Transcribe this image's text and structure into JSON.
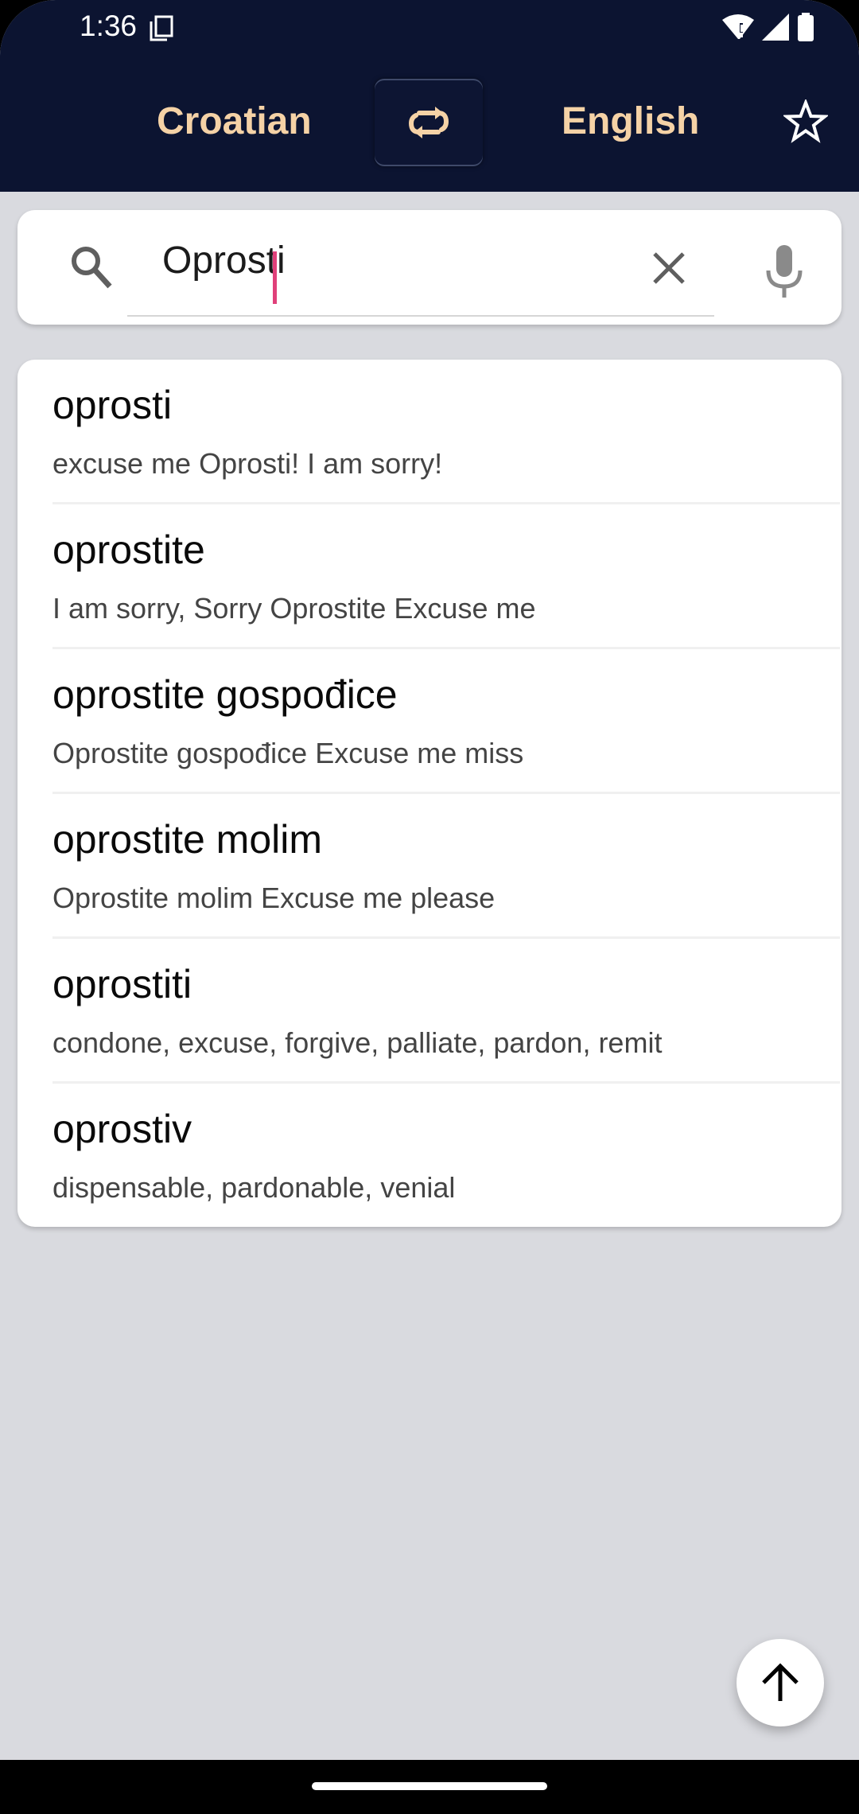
{
  "status_bar": {
    "time": "1:36",
    "icons": [
      "notification-note-icon",
      "wifi-alert-icon",
      "cellular-signal-icon",
      "battery-icon"
    ]
  },
  "header": {
    "source_language": "Croatian",
    "target_language": "English",
    "swap_icon": "swap-languages-icon",
    "favorite_icon": "star-outline-icon"
  },
  "search": {
    "value": "Oprosti",
    "placeholder": "",
    "search_icon": "search-icon",
    "clear_icon": "close-icon",
    "voice_icon": "microphone-icon"
  },
  "results": [
    {
      "word": "oprosti",
      "translation": "excuse me Oprosti! I am sorry!"
    },
    {
      "word": "oprostite",
      "translation": "I am sorry, Sorry Oprostite Excuse me"
    },
    {
      "word": "oprostite gospođice",
      "translation": "Oprostite gospođice Excuse me miss"
    },
    {
      "word": "oprostite molim",
      "translation": "Oprostite molim Excuse me please"
    },
    {
      "word": "oprostiti",
      "translation": "condone, excuse, forgive, palliate, pardon, remit"
    },
    {
      "word": "oprostiv",
      "translation": "dispensable, pardonable, venial"
    }
  ],
  "fab": {
    "icon": "arrow-up-icon"
  },
  "colors": {
    "header_bg": "#0c1431",
    "accent_text": "#f5d2a6",
    "caret": "#e0407a",
    "page_bg": "#d9dadf"
  }
}
